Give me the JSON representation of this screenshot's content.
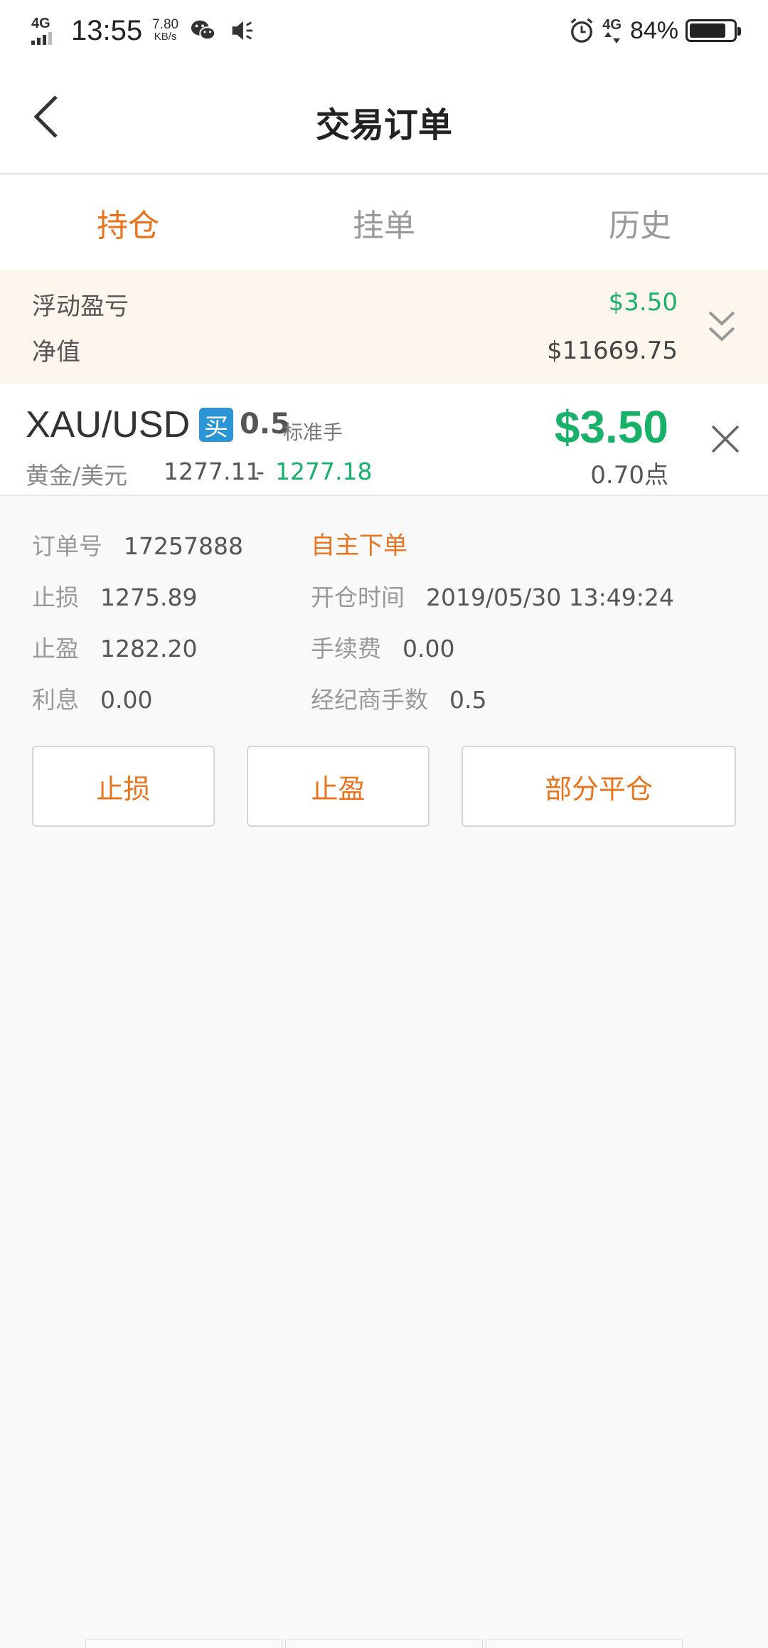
{
  "status_bar": {
    "network_left": "4G",
    "time": "13:55",
    "speed_value": "7.80",
    "speed_unit": "KB/s",
    "network_right": "4G",
    "battery": "84%",
    "battery_level": 0.84
  },
  "header": {
    "title": "交易订单",
    "back_icon": "chevron-left-icon"
  },
  "tabs": [
    {
      "label": "持仓",
      "active": true
    },
    {
      "label": "挂单",
      "active": false
    },
    {
      "label": "历史",
      "active": false
    }
  ],
  "summary": {
    "floating_pl_label": "浮动盈亏",
    "floating_pl_value": "$3.50",
    "equity_label": "净值",
    "equity_value": "$11669.75"
  },
  "position": {
    "symbol": "XAU/USD",
    "side": "买",
    "lots": "0.5",
    "lots_unit": "标准手",
    "symbol_cn": "黄金/美元",
    "open_price": "1277.11",
    "separator": "-",
    "current_price": "1277.18",
    "profit": "$3.50",
    "points": "0.70点"
  },
  "details": {
    "order_no_label": "订单号",
    "order_no": "17257888",
    "order_type": "自主下单",
    "sl_label": "止损",
    "sl_value": "1275.89",
    "open_time_label": "开仓时间",
    "open_time": "2019/05/30 13:49:24",
    "tp_label": "止盈",
    "tp_value": "1282.20",
    "fee_label": "手续费",
    "fee_value": "0.00",
    "interest_label": "利息",
    "interest_value": "0.00",
    "broker_lots_label": "经纪商手数",
    "broker_lots_value": "0.5"
  },
  "actions": {
    "stop_loss": "止损",
    "take_profit": "止盈",
    "partial_close": "部分平仓"
  },
  "colors": {
    "accent": "#e8741e",
    "profit": "#19b06a",
    "buy_badge": "#2b95d6",
    "summary_bg": "#fdf6ec"
  }
}
